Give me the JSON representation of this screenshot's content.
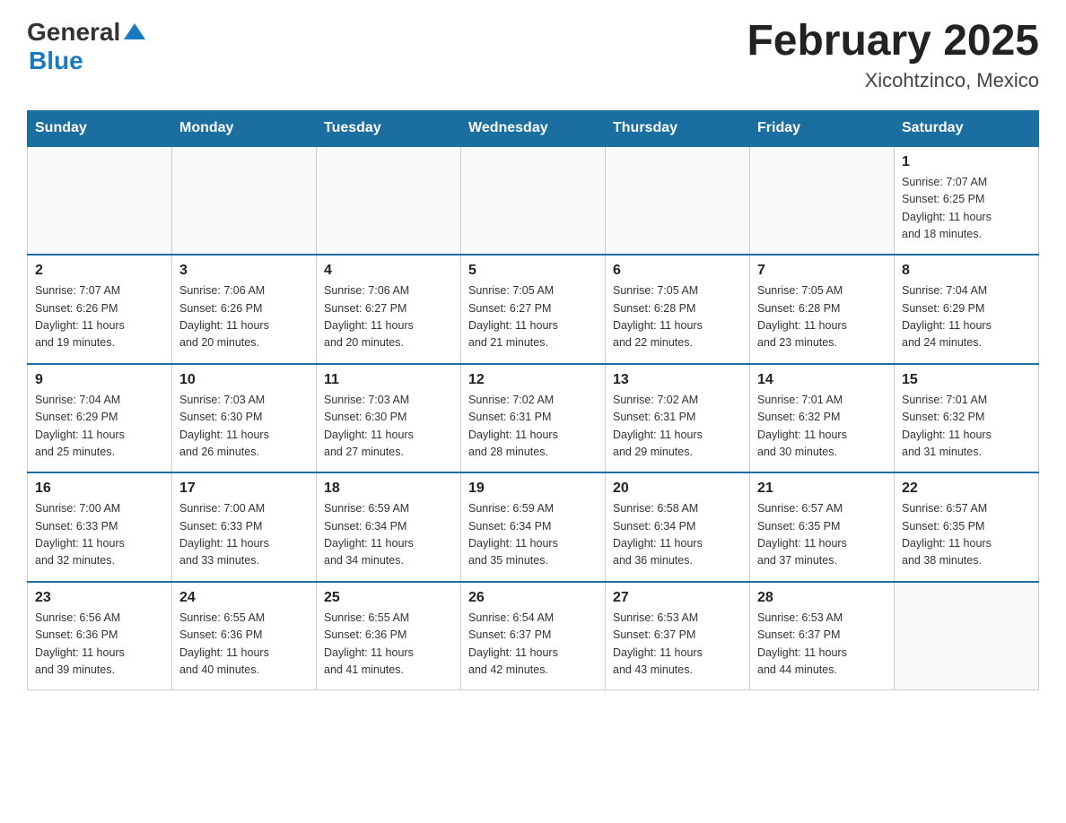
{
  "header": {
    "logo_general": "General",
    "logo_blue": "Blue",
    "month_year": "February 2025",
    "location": "Xicohtzinco, Mexico"
  },
  "days_of_week": [
    "Sunday",
    "Monday",
    "Tuesday",
    "Wednesday",
    "Thursday",
    "Friday",
    "Saturday"
  ],
  "weeks": [
    [
      {
        "day": "",
        "info": ""
      },
      {
        "day": "",
        "info": ""
      },
      {
        "day": "",
        "info": ""
      },
      {
        "day": "",
        "info": ""
      },
      {
        "day": "",
        "info": ""
      },
      {
        "day": "",
        "info": ""
      },
      {
        "day": "1",
        "info": "Sunrise: 7:07 AM\nSunset: 6:25 PM\nDaylight: 11 hours\nand 18 minutes."
      }
    ],
    [
      {
        "day": "2",
        "info": "Sunrise: 7:07 AM\nSunset: 6:26 PM\nDaylight: 11 hours\nand 19 minutes."
      },
      {
        "day": "3",
        "info": "Sunrise: 7:06 AM\nSunset: 6:26 PM\nDaylight: 11 hours\nand 20 minutes."
      },
      {
        "day": "4",
        "info": "Sunrise: 7:06 AM\nSunset: 6:27 PM\nDaylight: 11 hours\nand 20 minutes."
      },
      {
        "day": "5",
        "info": "Sunrise: 7:05 AM\nSunset: 6:27 PM\nDaylight: 11 hours\nand 21 minutes."
      },
      {
        "day": "6",
        "info": "Sunrise: 7:05 AM\nSunset: 6:28 PM\nDaylight: 11 hours\nand 22 minutes."
      },
      {
        "day": "7",
        "info": "Sunrise: 7:05 AM\nSunset: 6:28 PM\nDaylight: 11 hours\nand 23 minutes."
      },
      {
        "day": "8",
        "info": "Sunrise: 7:04 AM\nSunset: 6:29 PM\nDaylight: 11 hours\nand 24 minutes."
      }
    ],
    [
      {
        "day": "9",
        "info": "Sunrise: 7:04 AM\nSunset: 6:29 PM\nDaylight: 11 hours\nand 25 minutes."
      },
      {
        "day": "10",
        "info": "Sunrise: 7:03 AM\nSunset: 6:30 PM\nDaylight: 11 hours\nand 26 minutes."
      },
      {
        "day": "11",
        "info": "Sunrise: 7:03 AM\nSunset: 6:30 PM\nDaylight: 11 hours\nand 27 minutes."
      },
      {
        "day": "12",
        "info": "Sunrise: 7:02 AM\nSunset: 6:31 PM\nDaylight: 11 hours\nand 28 minutes."
      },
      {
        "day": "13",
        "info": "Sunrise: 7:02 AM\nSunset: 6:31 PM\nDaylight: 11 hours\nand 29 minutes."
      },
      {
        "day": "14",
        "info": "Sunrise: 7:01 AM\nSunset: 6:32 PM\nDaylight: 11 hours\nand 30 minutes."
      },
      {
        "day": "15",
        "info": "Sunrise: 7:01 AM\nSunset: 6:32 PM\nDaylight: 11 hours\nand 31 minutes."
      }
    ],
    [
      {
        "day": "16",
        "info": "Sunrise: 7:00 AM\nSunset: 6:33 PM\nDaylight: 11 hours\nand 32 minutes."
      },
      {
        "day": "17",
        "info": "Sunrise: 7:00 AM\nSunset: 6:33 PM\nDaylight: 11 hours\nand 33 minutes."
      },
      {
        "day": "18",
        "info": "Sunrise: 6:59 AM\nSunset: 6:34 PM\nDaylight: 11 hours\nand 34 minutes."
      },
      {
        "day": "19",
        "info": "Sunrise: 6:59 AM\nSunset: 6:34 PM\nDaylight: 11 hours\nand 35 minutes."
      },
      {
        "day": "20",
        "info": "Sunrise: 6:58 AM\nSunset: 6:34 PM\nDaylight: 11 hours\nand 36 minutes."
      },
      {
        "day": "21",
        "info": "Sunrise: 6:57 AM\nSunset: 6:35 PM\nDaylight: 11 hours\nand 37 minutes."
      },
      {
        "day": "22",
        "info": "Sunrise: 6:57 AM\nSunset: 6:35 PM\nDaylight: 11 hours\nand 38 minutes."
      }
    ],
    [
      {
        "day": "23",
        "info": "Sunrise: 6:56 AM\nSunset: 6:36 PM\nDaylight: 11 hours\nand 39 minutes."
      },
      {
        "day": "24",
        "info": "Sunrise: 6:55 AM\nSunset: 6:36 PM\nDaylight: 11 hours\nand 40 minutes."
      },
      {
        "day": "25",
        "info": "Sunrise: 6:55 AM\nSunset: 6:36 PM\nDaylight: 11 hours\nand 41 minutes."
      },
      {
        "day": "26",
        "info": "Sunrise: 6:54 AM\nSunset: 6:37 PM\nDaylight: 11 hours\nand 42 minutes."
      },
      {
        "day": "27",
        "info": "Sunrise: 6:53 AM\nSunset: 6:37 PM\nDaylight: 11 hours\nand 43 minutes."
      },
      {
        "day": "28",
        "info": "Sunrise: 6:53 AM\nSunset: 6:37 PM\nDaylight: 11 hours\nand 44 minutes."
      },
      {
        "day": "",
        "info": ""
      }
    ]
  ]
}
